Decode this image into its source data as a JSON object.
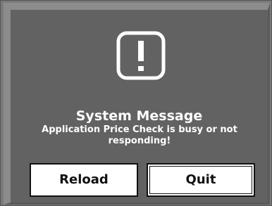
{
  "dialog": {
    "icon": "exclamation-warning-icon",
    "title": "System Message",
    "message": "Application Price Check is busy or not responding!",
    "buttons": {
      "reload_label": "Reload",
      "quit_label": "Quit"
    }
  },
  "colors": {
    "dialog_background": "#626262",
    "frame_light": "#8c8c8c",
    "icon_color": "#ffffff",
    "text_color": "#ffffff",
    "button_background": "#ffffff",
    "button_text": "#111111"
  }
}
